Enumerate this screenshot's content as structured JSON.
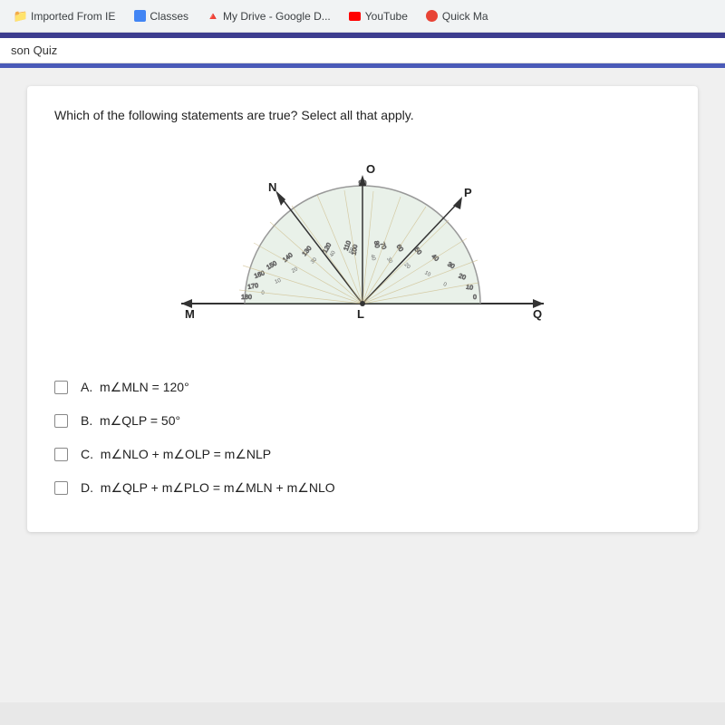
{
  "bookmarks": {
    "items": [
      {
        "label": "Imported From IE",
        "icon": "folder"
      },
      {
        "label": "Classes",
        "icon": "classes"
      },
      {
        "label": "My Drive - Google D...",
        "icon": "drive"
      },
      {
        "label": "YouTube",
        "icon": "youtube"
      },
      {
        "label": "Quick Ma",
        "icon": "quickma"
      }
    ]
  },
  "lesson": {
    "title": "son Quiz"
  },
  "question": {
    "text": "Which of the following statements are true? Select all that apply."
  },
  "answers": [
    {
      "id": "A",
      "label": "m∠MLN = 120°"
    },
    {
      "id": "B",
      "label": "m∠QLP = 50°"
    },
    {
      "id": "C",
      "label": "m∠NLO + m∠OLP = m∠NLP"
    },
    {
      "id": "D",
      "label": "m∠QLP + m∠PLO = m∠MLN + m∠NLO"
    }
  ]
}
